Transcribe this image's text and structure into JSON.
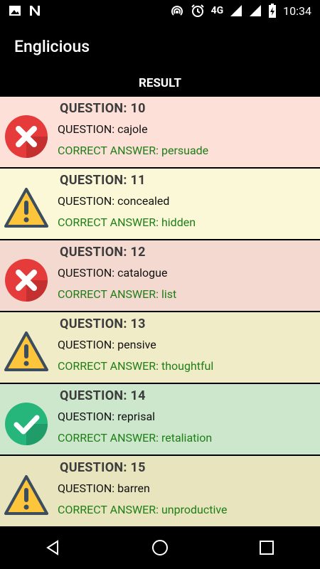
{
  "status_bar": {
    "time": "10:34",
    "network": "4G",
    "icons": [
      "image-icon",
      "n-icon",
      "hotspot-icon",
      "alarm-icon",
      "signal-icon",
      "signal-icon",
      "battery-icon"
    ]
  },
  "app_bar": {
    "title": "Englicious"
  },
  "result": {
    "header": "RESULT"
  },
  "colors": {
    "wrong_bg": "#fde1d8",
    "skip_bg": "#fbf8d7",
    "correct_bg": "#cce7cb",
    "answer": "#1f7f17"
  },
  "items": [
    {
      "status": "wrong",
      "title": "QUESTION: 10",
      "question": "QUESTION: cajole",
      "answer": "CORRECT ANSWER: persuade",
      "bg": "#fde0d8"
    },
    {
      "status": "skip",
      "title": "QUESTION: 11",
      "question": "QUESTION: concealed",
      "answer": "CORRECT ANSWER: hidden",
      "bg": "#fbf8d7"
    },
    {
      "status": "wrong",
      "title": "QUESTION: 12",
      "question": "QUESTION: catalogue",
      "answer": "CORRECT ANSWER: list",
      "bg": "#f3d9cf"
    },
    {
      "status": "skip",
      "title": "QUESTION: 13",
      "question": "QUESTION: pensive",
      "answer": "CORRECT ANSWER: thoughtful",
      "bg": "#f0ecc8"
    },
    {
      "status": "correct",
      "title": "QUESTION: 14",
      "question": "QUESTION: reprisal",
      "answer": "CORRECT ANSWER: retaliation",
      "bg": "#cce7cb"
    },
    {
      "status": "skip",
      "title": "QUESTION: 15",
      "question": "QUESTION: barren",
      "answer": "CORRECT ANSWER: unproductive",
      "bg": "#e8e4bd"
    }
  ],
  "nav": {
    "icons": [
      "back-icon",
      "home-icon",
      "recents-icon"
    ]
  }
}
